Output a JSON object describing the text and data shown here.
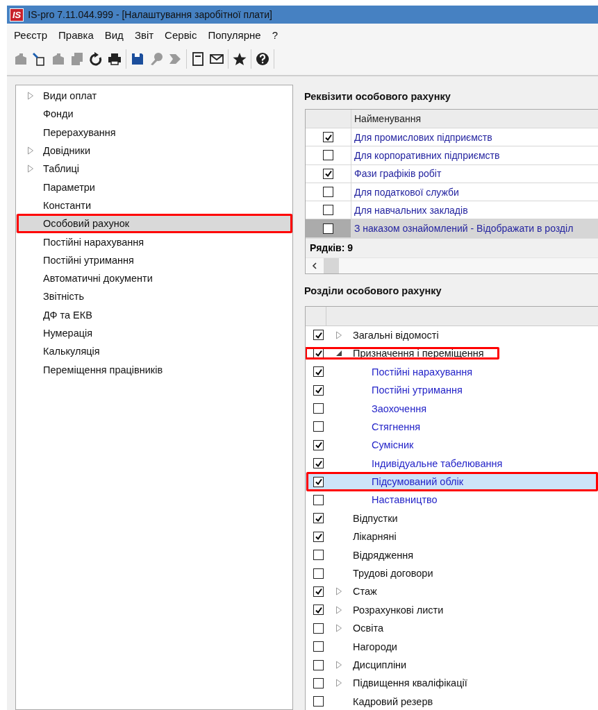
{
  "window": {
    "logo": "IS",
    "title": "IS-pro 7.11.044.999 - [Налаштування заробітної плати]"
  },
  "menu": [
    "Реєстр",
    "Правка",
    "Вид",
    "Звіт",
    "Сервіс",
    "Популярне",
    "?"
  ],
  "toolbar": [
    [
      {
        "kind": "add",
        "disabled": true
      },
      {
        "kind": "edit",
        "disabled": false
      },
      {
        "kind": "copy",
        "disabled": true
      },
      {
        "kind": "duplicate",
        "disabled": true
      },
      {
        "kind": "refresh",
        "disabled": false
      },
      {
        "kind": "print",
        "disabled": false
      }
    ],
    [
      {
        "kind": "save",
        "disabled": false
      },
      {
        "kind": "pin",
        "disabled": true
      },
      {
        "kind": "forward",
        "disabled": true
      }
    ],
    [
      {
        "kind": "note",
        "disabled": false
      },
      {
        "kind": "mail",
        "disabled": false
      }
    ],
    [
      {
        "kind": "star",
        "disabled": false
      }
    ],
    [
      {
        "kind": "help",
        "disabled": false
      }
    ]
  ],
  "sidebar": {
    "items": [
      {
        "label": "Види оплат",
        "expanded": false,
        "selected": false
      },
      {
        "label": "Фонди",
        "selected": false
      },
      {
        "label": "Перерахування",
        "selected": false
      },
      {
        "label": "Довідники",
        "expanded": false,
        "selected": false
      },
      {
        "label": "Таблиці",
        "expanded": false,
        "selected": false
      },
      {
        "label": "Параметри",
        "selected": false
      },
      {
        "label": "Константи",
        "selected": false
      },
      {
        "label": "Особовий рахунок",
        "selected": true,
        "highlighted": true
      },
      {
        "label": "Постійні нарахування",
        "selected": false
      },
      {
        "label": "Постійні утримання",
        "selected": false
      },
      {
        "label": "Автоматичні документи",
        "selected": false
      },
      {
        "label": "Звітність",
        "selected": false
      },
      {
        "label": "ДФ та ЕКВ",
        "selected": false
      },
      {
        "label": "Нумерація",
        "selected": false
      },
      {
        "label": "Калькуляція",
        "selected": false
      },
      {
        "label": "Переміщення працівників",
        "selected": false
      }
    ]
  },
  "requisites": {
    "title": "Реквізити особового рахунку",
    "columns": [
      "Найменування"
    ],
    "rows": [
      {
        "checked": true,
        "name": "Для промислових підприємств",
        "selected": false
      },
      {
        "checked": false,
        "name": "Для корпоративних підприємств",
        "selected": false
      },
      {
        "checked": true,
        "name": "Фази графіків робіт",
        "selected": false
      },
      {
        "checked": false,
        "name": "Для податкової служби",
        "selected": false
      },
      {
        "checked": false,
        "name": "Для навчальних закладів",
        "selected": false
      },
      {
        "checked": false,
        "name": "З наказом ознайомлений - Відображати в розділ",
        "selected": true
      }
    ],
    "footer": "Рядків: 9"
  },
  "sections": {
    "title": "Розділи особового рахунку",
    "rows": [
      {
        "checked": true,
        "label": "Загальні відомості",
        "expanded": false,
        "selected": false
      },
      {
        "checked": true,
        "label": "Призначення і переміщення",
        "expanded": true,
        "selected": false,
        "highlighted": true,
        "children": [
          {
            "checked": true,
            "label": "Постійні нарахування",
            "selected": false
          },
          {
            "checked": true,
            "label": "Постійні утримання",
            "selected": false
          },
          {
            "checked": false,
            "label": "Заохочення",
            "selected": false
          },
          {
            "checked": false,
            "label": "Стягнення",
            "selected": false
          },
          {
            "checked": true,
            "label": "Сумісник",
            "selected": false
          },
          {
            "checked": true,
            "label": "Індивідуальне табелювання",
            "selected": false
          },
          {
            "checked": true,
            "label": "Підсумований облік",
            "selected": true,
            "highlighted": true
          },
          {
            "checked": false,
            "label": "Наставництво",
            "selected": false
          }
        ]
      },
      {
        "checked": true,
        "label": "Відпустки",
        "selected": false
      },
      {
        "checked": true,
        "label": "Лікарняні",
        "selected": false
      },
      {
        "checked": false,
        "label": "Відрядження",
        "selected": false
      },
      {
        "checked": false,
        "label": "Трудові договори",
        "selected": false
      },
      {
        "checked": true,
        "label": "Стаж",
        "expanded": false,
        "selected": false
      },
      {
        "checked": true,
        "label": "Розрахункові листи",
        "expanded": false,
        "selected": false
      },
      {
        "checked": false,
        "label": "Освіта",
        "expanded": false,
        "selected": false
      },
      {
        "checked": false,
        "label": "Нагороди",
        "selected": false
      },
      {
        "checked": false,
        "label": "Дисципліни",
        "expanded": false,
        "selected": false
      },
      {
        "checked": false,
        "label": "Підвищення кваліфікації",
        "expanded": false,
        "selected": false
      },
      {
        "checked": false,
        "label": "Кадровий резерв",
        "selected": false
      }
    ]
  }
}
